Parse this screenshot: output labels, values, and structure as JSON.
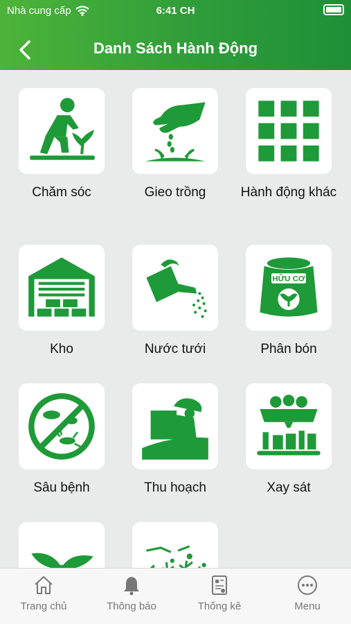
{
  "status_bar": {
    "carrier": "Nhà cung cấp",
    "time": "6:41 CH"
  },
  "header": {
    "title": "Danh Sách Hành Động"
  },
  "actions": [
    {
      "label": "Chăm sóc",
      "icon": "gardener-icon"
    },
    {
      "label": "Gieo trồng",
      "icon": "sowing-icon"
    },
    {
      "label": "Hành động khác",
      "icon": "grid-icon"
    },
    {
      "label": "Kho",
      "icon": "warehouse-icon"
    },
    {
      "label": "Nước tưới",
      "icon": "watering-can-icon"
    },
    {
      "label": "Phân bón",
      "icon": "fertilizer-bag-icon",
      "bag_text": "HỮU CƠ"
    },
    {
      "label": "Sâu bệnh",
      "icon": "no-pests-icon"
    },
    {
      "label": "Thu hoạch",
      "icon": "harvest-icon"
    },
    {
      "label": "Xay sát",
      "icon": "processing-factory-icon"
    },
    {
      "label": "",
      "icon": "seedling-icon"
    },
    {
      "label": "",
      "icon": "weeds-icon"
    }
  ],
  "tabbar": {
    "items": [
      {
        "label": "Trang chủ",
        "icon": "home-icon"
      },
      {
        "label": "Thông báo",
        "icon": "bell-icon"
      },
      {
        "label": "Thống kê",
        "icon": "report-icon"
      },
      {
        "label": "Menu",
        "icon": "more-icon"
      }
    ]
  },
  "colors": {
    "header": "#2f9d3a",
    "icon_green": "#1e9a38",
    "background": "#e9ebea"
  }
}
